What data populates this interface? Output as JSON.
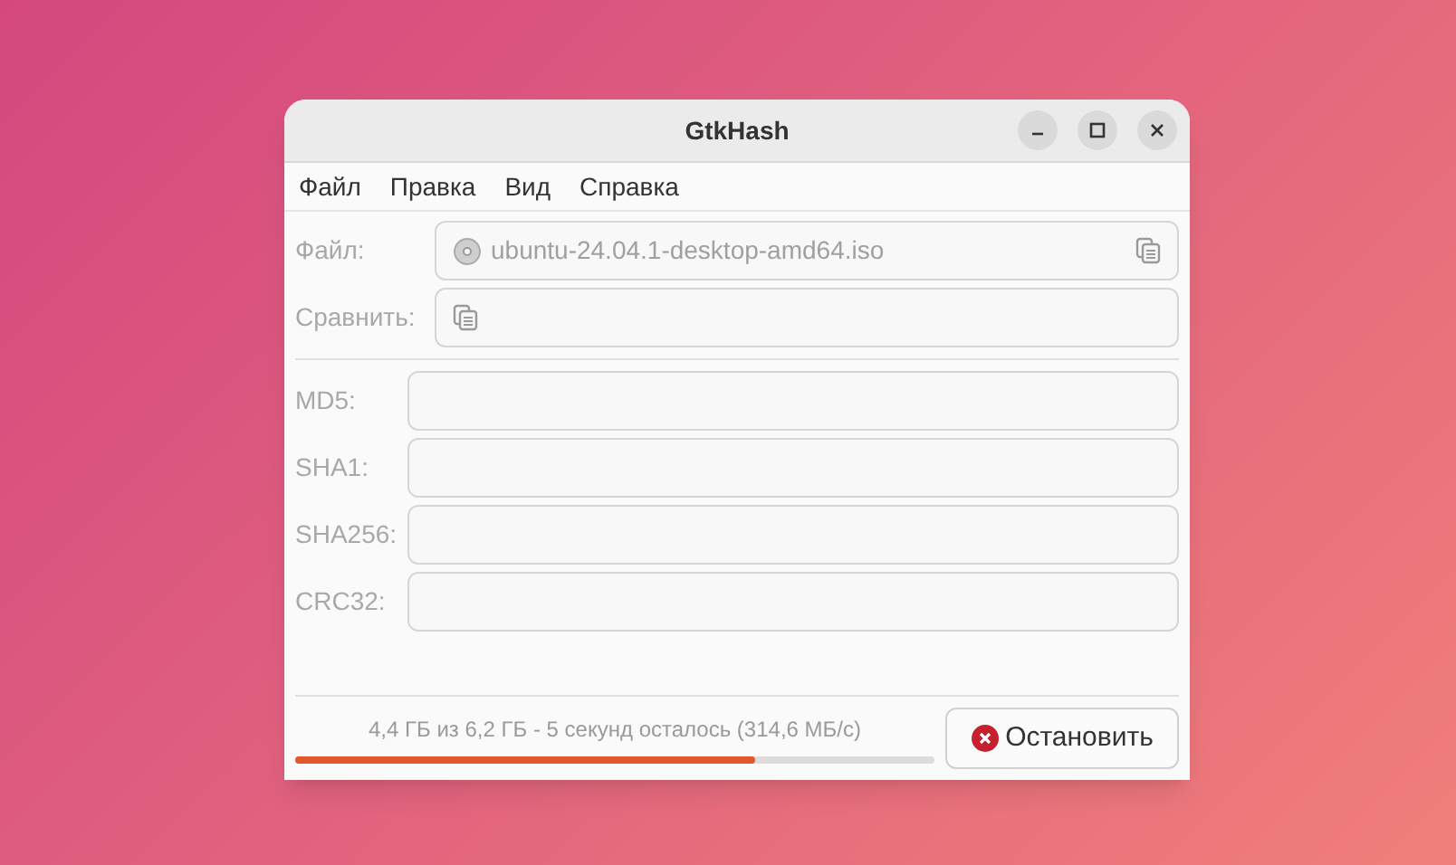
{
  "window": {
    "title": "GtkHash"
  },
  "menu": [
    "Файл",
    "Правка",
    "Вид",
    "Справка"
  ],
  "file": {
    "label": "Файл:",
    "value": "ubuntu-24.04.1-desktop-amd64.iso",
    "disabled": true
  },
  "compare": {
    "label": "Сравнить:",
    "disabled": true
  },
  "hashes": [
    {
      "label": "MD5:",
      "disabled": true
    },
    {
      "label": "SHA1:",
      "disabled": true
    },
    {
      "label": "SHA256:",
      "disabled": true
    },
    {
      "label": "CRC32:",
      "disabled": true
    }
  ],
  "progress": {
    "text": "4,4 ГБ из 6,2 ГБ - 5 секунд осталось (314,6 МБ/с)",
    "level": 0.72
  },
  "stop_button": {
    "label": "Остановить"
  }
}
